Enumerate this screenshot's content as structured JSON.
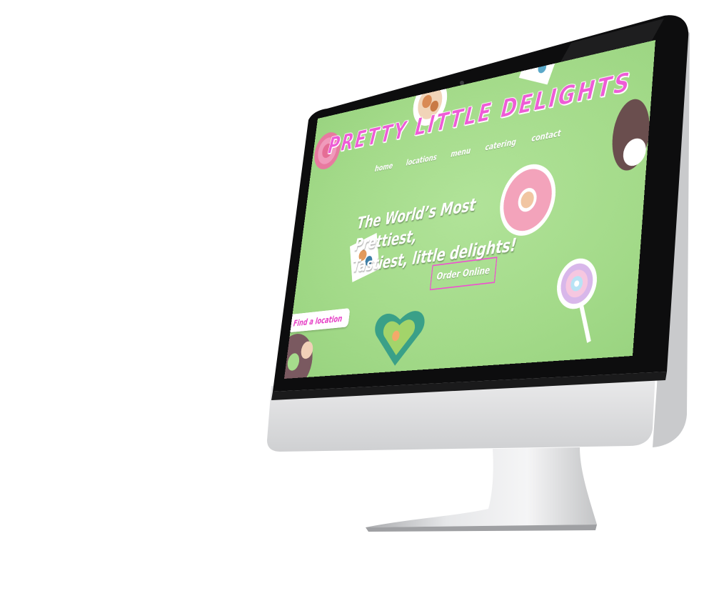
{
  "site": {
    "logo": "PRETTY LITTLE DELIGHTS",
    "nav": [
      "home",
      "locations",
      "menu",
      "catering",
      "contact"
    ],
    "hero_line1": "The World’s Most Prettiest,",
    "hero_line2": "Tastiest, little delights!",
    "order_button": "Order Online",
    "find_button": "Find a location"
  },
  "colors": {
    "background_green": "#a6dc8c",
    "accent_pink": "#ee5cd6",
    "text_white": "#ffffff"
  }
}
